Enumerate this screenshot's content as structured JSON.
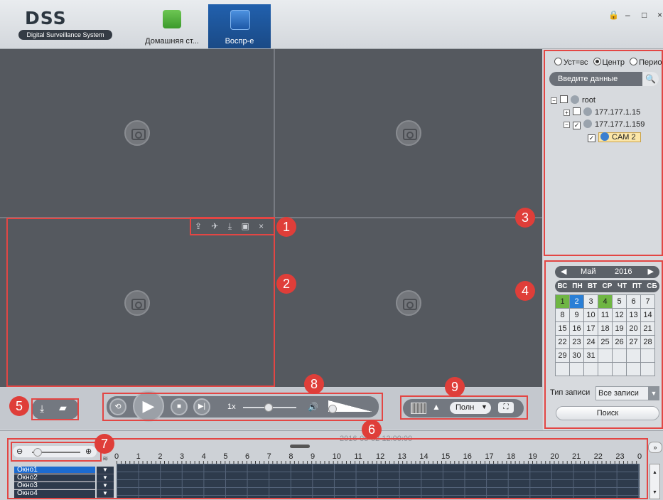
{
  "header": {
    "logo_title": "DSS",
    "logo_subtitle": "Digital Surveillance System",
    "tabs": [
      {
        "label": "Домашняя ст..."
      },
      {
        "label": "Воспр-е"
      }
    ],
    "window_buttons": {
      "lock": "🔒",
      "minimize": "–",
      "maximize": "□",
      "close": "×"
    }
  },
  "video_panes": {
    "tools": {
      "export": "⇪",
      "pin": "✈",
      "download": "⤓",
      "snapshot": "▣",
      "close": "×"
    }
  },
  "markers": [
    "1",
    "2",
    "3",
    "4",
    "5",
    "6",
    "7",
    "8",
    "9"
  ],
  "device_panel": {
    "radio_options": [
      {
        "label": "Уст=вс",
        "selected": false
      },
      {
        "label": "Центр",
        "selected": true
      },
      {
        "label": "Период",
        "selected": false
      }
    ],
    "search_placeholder": "Введите данные",
    "tree": [
      {
        "label": "root",
        "checked": false
      },
      {
        "label": "177.177.1.15",
        "checked": false
      },
      {
        "label": "177.177.1.159",
        "checked": true
      },
      {
        "label": "CAM 2",
        "checked": true
      }
    ]
  },
  "calendar": {
    "month": "Май",
    "year": "2016",
    "weekdays": [
      "ВС",
      "ПН",
      "ВТ",
      "СР",
      "ЧТ",
      "ПТ",
      "СБ"
    ],
    "weeks": [
      [
        "1",
        "2",
        "3",
        "4",
        "5",
        "6",
        "7"
      ],
      [
        "8",
        "9",
        "10",
        "11",
        "12",
        "13",
        "14"
      ],
      [
        "15",
        "16",
        "17",
        "18",
        "19",
        "20",
        "21"
      ],
      [
        "22",
        "23",
        "24",
        "25",
        "26",
        "27",
        "28"
      ],
      [
        "29",
        "30",
        "31",
        "",
        "",
        "",
        ""
      ],
      [
        "",
        "",
        "",
        "",
        "",
        "",
        ""
      ]
    ],
    "record_days": [
      "1",
      "4"
    ],
    "selected_day": "2",
    "record_type_label": "Тип записи",
    "record_type_value": "Все записи",
    "search_button": "Поиск"
  },
  "playback": {
    "speed": "1x",
    "fit_label": "Полн"
  },
  "timeline": {
    "timestamp": "2016-05-02 12:00:00",
    "hours": [
      "0",
      "1",
      "2",
      "3",
      "4",
      "5",
      "6",
      "7",
      "8",
      "9",
      "10",
      "11",
      "12",
      "13",
      "14",
      "15",
      "16",
      "17",
      "18",
      "19",
      "20",
      "21",
      "22",
      "23",
      "0"
    ],
    "channels": [
      "Окно1",
      "Окно2",
      "Окно3",
      "Окно4"
    ]
  }
}
